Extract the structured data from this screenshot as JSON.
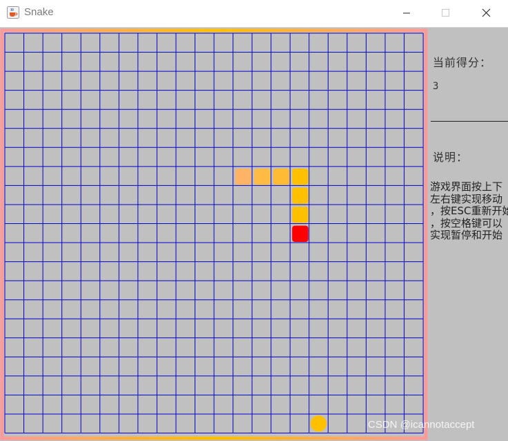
{
  "window": {
    "title": "Snake",
    "icon": "java-coffee-icon",
    "controls": [
      "minimize-icon",
      "maximize-icon",
      "close-icon"
    ]
  },
  "board": {
    "columns": 22,
    "rows": 21,
    "grid_color": "#0000cc",
    "background": "#c0c0c0",
    "border_colors": [
      "#ffc000",
      "#ff9999"
    ],
    "snake": [
      {
        "col": 15,
        "row": 10,
        "part": "head",
        "color": "#ff0000"
      },
      {
        "col": 15,
        "row": 9,
        "part": "body",
        "color": "#ffc000"
      },
      {
        "col": 15,
        "row": 8,
        "part": "body",
        "color": "#ffc000"
      },
      {
        "col": 15,
        "row": 7,
        "part": "body",
        "color": "#ffc000"
      },
      {
        "col": 14,
        "row": 7,
        "part": "body",
        "color": "#ffbb33"
      },
      {
        "col": 13,
        "row": 7,
        "part": "body",
        "color": "#ffbb44"
      },
      {
        "col": 12,
        "row": 7,
        "part": "tail",
        "color": "#ffb366"
      }
    ],
    "food": {
      "col": 16,
      "row": 20,
      "color": "#ffc000"
    }
  },
  "side_panel": {
    "score_label": "当前得分：",
    "score_value": "3",
    "help_label": "说明：",
    "help_lines": [
      "游戏界面按上下",
      "左右键实现移动",
      "，按ESC重新开始",
      "，按空格键可以",
      "实现暂停和开始"
    ]
  },
  "watermark": "CSDN @icannotaccept"
}
